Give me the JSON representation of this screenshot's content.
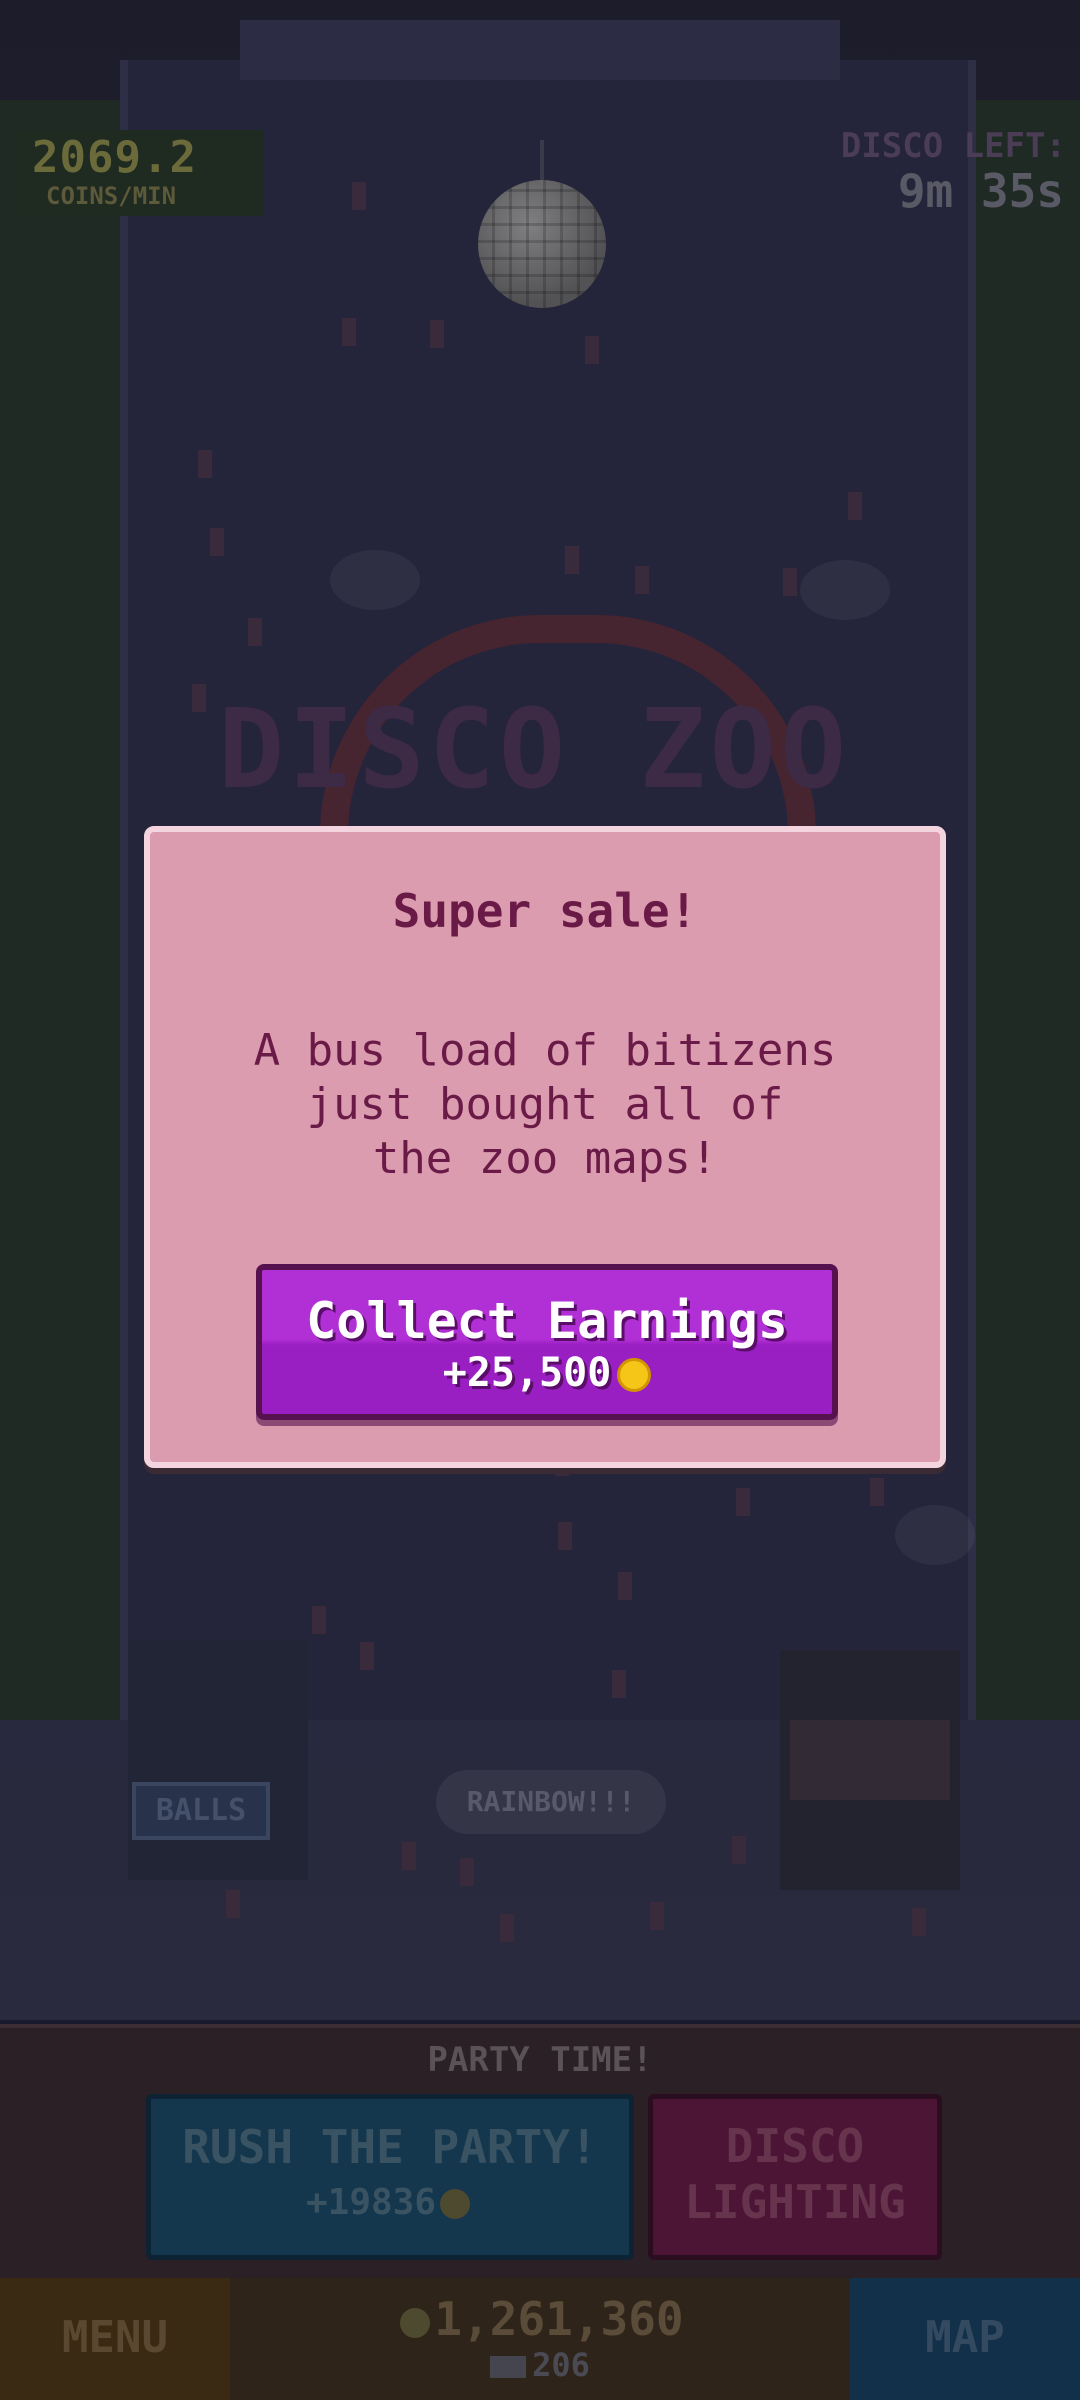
{
  "hud": {
    "rate_value": "2069.2",
    "rate_label": "COINS/MIN",
    "disco_label": "DISCO LEFT:",
    "disco_time": "9m 35s"
  },
  "scene": {
    "logo_text": "DISCO ZOO",
    "balls_sign": "BALLS",
    "rainbow_sign": "RAINBOW!!!"
  },
  "dialog": {
    "title": "Super sale!",
    "body": "A bus load of bitizens\njust bought all of\nthe zoo maps!",
    "collect_label": "Collect Earnings",
    "collect_amount": "+25,500",
    "coin_icon": "gold-coin-icon"
  },
  "bottom": {
    "party_title": "PARTY TIME!",
    "rush_label": "RUSH THE PARTY!",
    "rush_value": "+19836",
    "disco_lighting": "DISCO\nLIGHTING",
    "menu": "MENU",
    "coins": "1,261,360",
    "bux": "206",
    "map": "MAP"
  },
  "colors": {
    "dialog_bg": "#dc9cb0",
    "dialog_text": "#6a1a46",
    "button_purple": "#b130d6",
    "coin_gold": "#f5c518"
  }
}
